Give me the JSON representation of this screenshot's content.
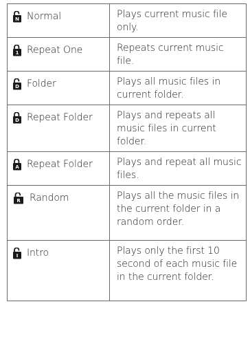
{
  "modes": [
    {
      "icon_name": "play-mode-normal-icon",
      "icon_letter": "N",
      "label": "Normal",
      "description": "Plays current music file only."
    },
    {
      "icon_name": "play-mode-repeat-one-icon",
      "icon_letter": "1",
      "label": "Repeat One",
      "description": "Repeats current music file."
    },
    {
      "icon_name": "play-mode-folder-icon",
      "icon_letter": "D",
      "label": "Folder",
      "description": "Plays all music files in current folder."
    },
    {
      "icon_name": "play-mode-repeat-folder-icon",
      "icon_letter": "D",
      "label": "Repeat Folder",
      "description": "Plays and repeats all music files in current folder."
    },
    {
      "icon_name": "play-mode-repeat-all-icon",
      "icon_letter": "A",
      "label": "Repeat Folder",
      "description": "Plays and repeat all music files."
    },
    {
      "icon_name": "play-mode-random-icon",
      "icon_letter": "R",
      "label": "Random",
      "description": "Plays all the music files in the current folder in a random order."
    },
    {
      "icon_name": "play-mode-intro-icon",
      "icon_letter": "I",
      "label": "Intro",
      "description": "Plays only the first 10 second of each music file in the current folder."
    }
  ]
}
